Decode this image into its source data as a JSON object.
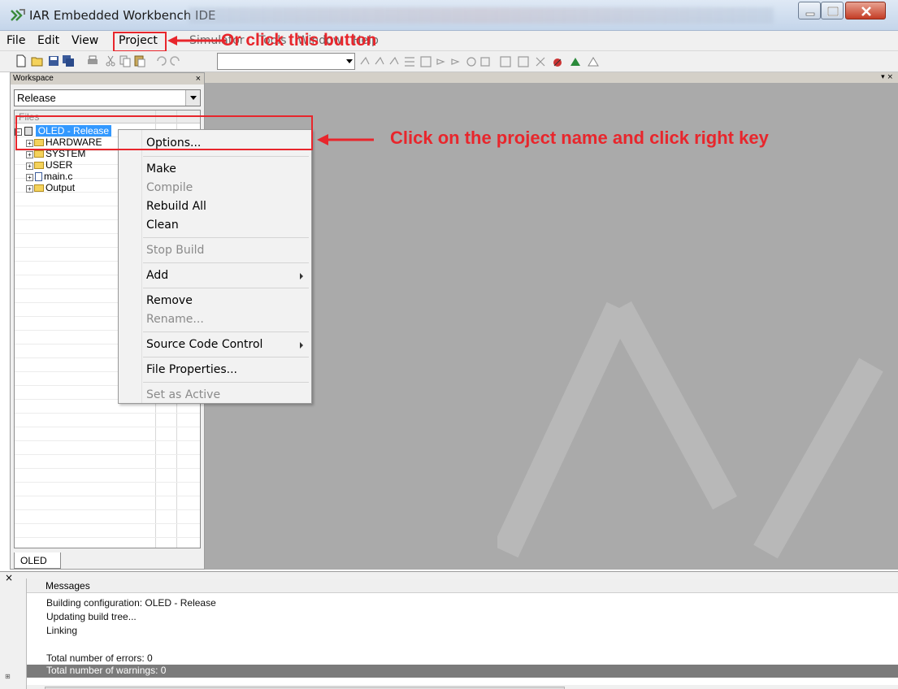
{
  "window": {
    "title": "IAR Embedded Workbench IDE"
  },
  "menubar": {
    "items": [
      "File",
      "Edit",
      "View",
      "Project",
      "Simulator",
      "Tools",
      "Window",
      "Help"
    ]
  },
  "workspace": {
    "header": "Workspace",
    "config": "Release",
    "files_header": "Files",
    "tree": [
      {
        "label": "OLED - Release",
        "type": "project"
      },
      {
        "label": "HARDWARE",
        "type": "folder"
      },
      {
        "label": "SYSTEM",
        "type": "folder"
      },
      {
        "label": "USER",
        "type": "folder"
      },
      {
        "label": "main.c",
        "type": "file"
      },
      {
        "label": "Output",
        "type": "folder"
      }
    ],
    "tab": "OLED"
  },
  "context_menu": {
    "items": [
      {
        "label": "Options...",
        "enabled": true
      },
      {
        "label": "Make",
        "enabled": true
      },
      {
        "label": "Compile",
        "enabled": false
      },
      {
        "label": "Rebuild All",
        "enabled": true
      },
      {
        "label": "Clean",
        "enabled": true
      },
      {
        "label": "Stop Build",
        "enabled": false
      },
      {
        "label": "Add",
        "enabled": true,
        "submenu": true
      },
      {
        "label": "Remove",
        "enabled": true
      },
      {
        "label": "Rename...",
        "enabled": false
      },
      {
        "label": "Source Code Control",
        "enabled": true,
        "submenu": true
      },
      {
        "label": "File Properties...",
        "enabled": true
      },
      {
        "label": "Set as Active",
        "enabled": false
      }
    ]
  },
  "annotations": {
    "menu_hint": "Or click this button",
    "project_hint": "Click on the project name and  click right key",
    "color": "#e8262c"
  },
  "messages": {
    "header": "Messages",
    "lines": [
      "Building configuration: OLED - Release",
      "Updating build tree...",
      "Linking",
      "",
      "Total number of errors: 0",
      "Total number of warnings: 0"
    ]
  },
  "icons": {
    "toolbar": [
      "new-file-icon",
      "open-icon",
      "save-icon",
      "save-all-icon",
      "print-icon",
      "cut-icon",
      "copy-icon",
      "paste-icon",
      "undo-icon",
      "redo-icon"
    ]
  }
}
